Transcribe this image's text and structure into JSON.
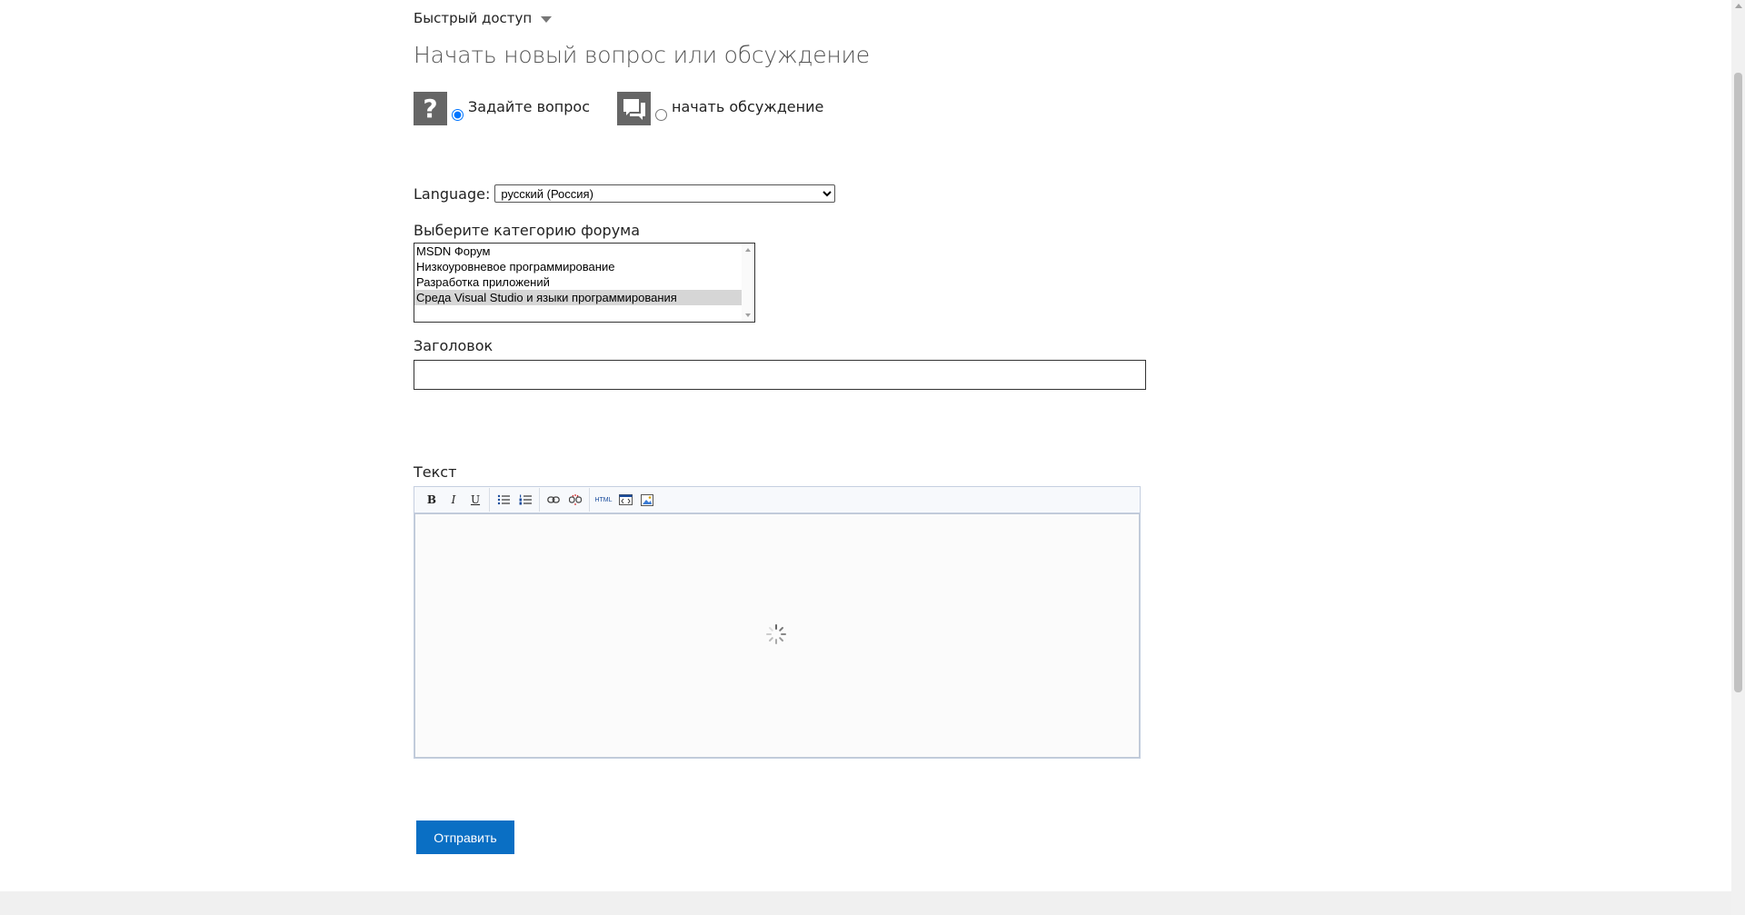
{
  "quick_access": {
    "label": "Быстрый доступ"
  },
  "page_title": "Начать новый вопрос или обсуждение",
  "post_type": {
    "options": [
      {
        "label": "Задайте вопрос",
        "selected": true,
        "icon": "question-icon"
      },
      {
        "label": "начать обсуждение",
        "selected": false,
        "icon": "discussion-icon"
      }
    ]
  },
  "language": {
    "label": "Language:",
    "selected": "русский (Россия)"
  },
  "category": {
    "label": "Выберите категорию форума",
    "items": [
      {
        "label": "MSDN Форум",
        "selected": false
      },
      {
        "label": "Низкоуровневое программирование",
        "selected": false
      },
      {
        "label": "Разработка приложений",
        "selected": false
      },
      {
        "label": "Среда Visual Studio и языки программирования",
        "selected": true
      }
    ]
  },
  "title_field": {
    "label": "Заголовок",
    "value": ""
  },
  "text_field": {
    "label": "Текст",
    "toolbar": {
      "bold": "B",
      "italic": "I",
      "underline": "U",
      "html": "HTML"
    }
  },
  "submit": {
    "label": "Отправить"
  },
  "colors": {
    "accent": "#0a6fc4",
    "icon_bg": "#666666",
    "selected_item": "#d6d6d6"
  }
}
